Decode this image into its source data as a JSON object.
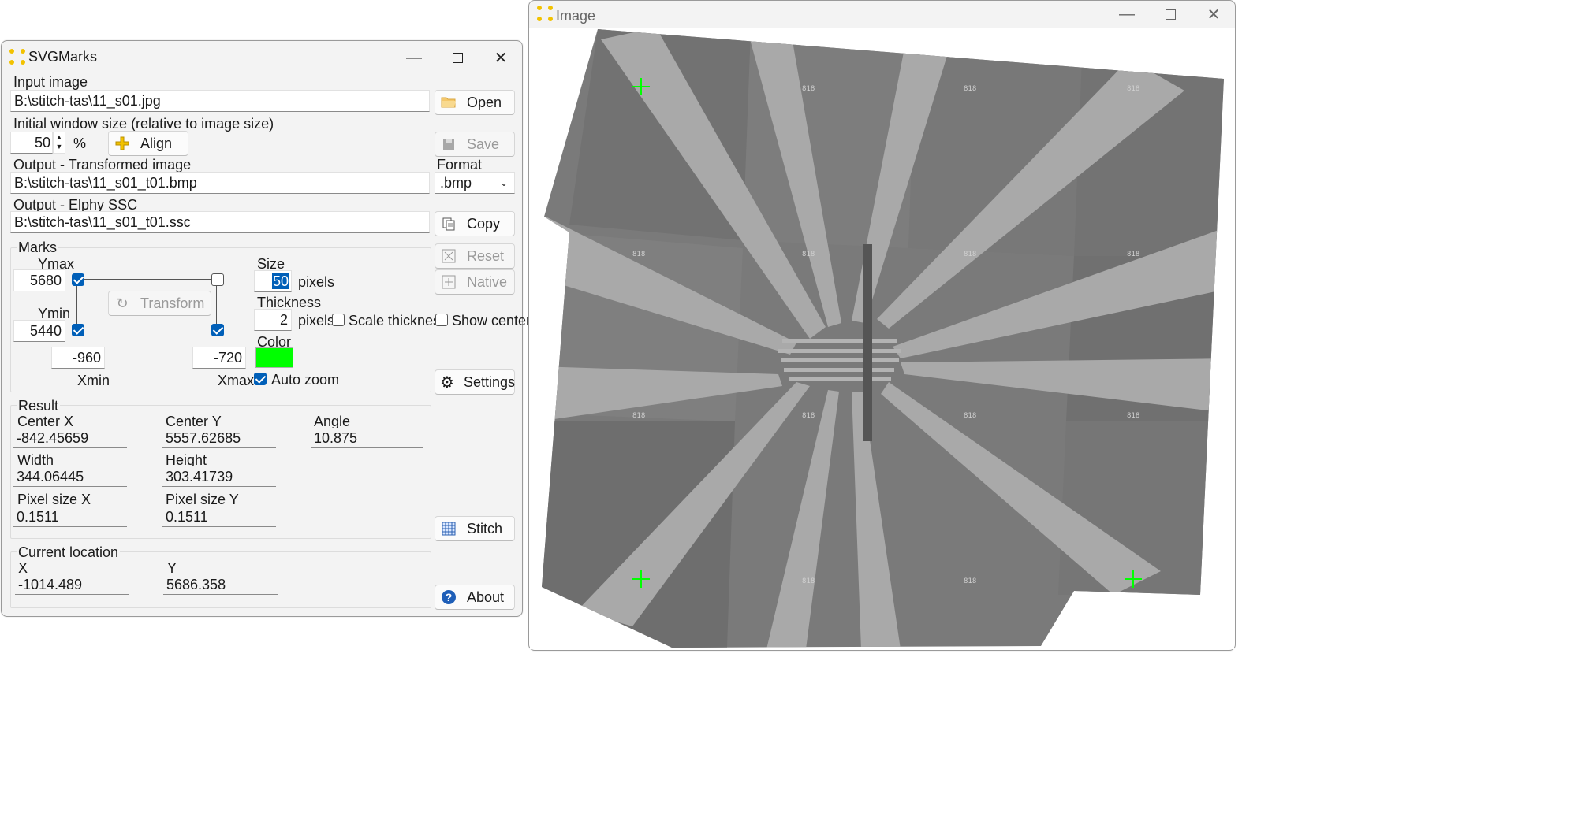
{
  "main_window": {
    "title": "SVGMarks",
    "input_image_label": "Input image",
    "input_image_path": "B:\\stitch-tas\\11_s01.jpg",
    "open_button": "Open",
    "initial_size_label": "Initial window size (relative to image size)",
    "initial_size_value": "50",
    "percent_unit": "%",
    "align_button": "Align",
    "save_button": "Save",
    "output_transformed_label": "Output - Transformed image",
    "output_transformed_path": "B:\\stitch-tas\\11_s01_t01.bmp",
    "format_label": "Format",
    "format_value": ".bmp",
    "output_ssc_label": "Output - Elphy SSC",
    "output_ssc_path": "B:\\stitch-tas\\11_s01_t01.ssc",
    "copy_button": "Copy",
    "reset_button": "Reset",
    "native_button": "Native",
    "show_center_label": "Show center",
    "settings_button": "Settings",
    "stitch_button": "Stitch",
    "about_button": "About",
    "marks": {
      "group_label": "Marks",
      "ymax_label": "Ymax",
      "ymax_value": "5680",
      "ymin_label": "Ymin",
      "ymin_value": "5440",
      "xmin_label": "Xmin",
      "xmin_value": "-960",
      "xmax_label": "Xmax",
      "xmax_value": "-720",
      "transform_button": "Transform",
      "size_label": "Size",
      "size_value": "50",
      "size_unit": "pixels",
      "thickness_label": "Thickness",
      "thickness_value": "2",
      "thickness_unit": "pixels",
      "scale_thickness_label": "Scale thickness",
      "color_label": "Color",
      "color_value": "#00ff00",
      "auto_zoom_label": "Auto zoom"
    },
    "result": {
      "group_label": "Result",
      "center_x_label": "Center X",
      "center_x": "-842.45659",
      "center_y_label": "Center Y",
      "center_y": "5557.62685",
      "angle_label": "Angle",
      "angle": "10.875",
      "width_label": "Width",
      "width": "344.06445",
      "height_label": "Height",
      "height": "303.41739",
      "pixel_x_label": "Pixel size X",
      "pixel_x": "0.1511",
      "pixel_y_label": "Pixel size Y",
      "pixel_y": "0.1511"
    },
    "location": {
      "group_label": "Current location",
      "x_label": "X",
      "x": "-1014.489",
      "y_label": "Y",
      "y": "5686.358"
    }
  },
  "image_window": {
    "title": "Image"
  },
  "colors": {
    "accent": "#005fb8",
    "mark_color": "#00ff00",
    "background": "#f3f3f3"
  }
}
